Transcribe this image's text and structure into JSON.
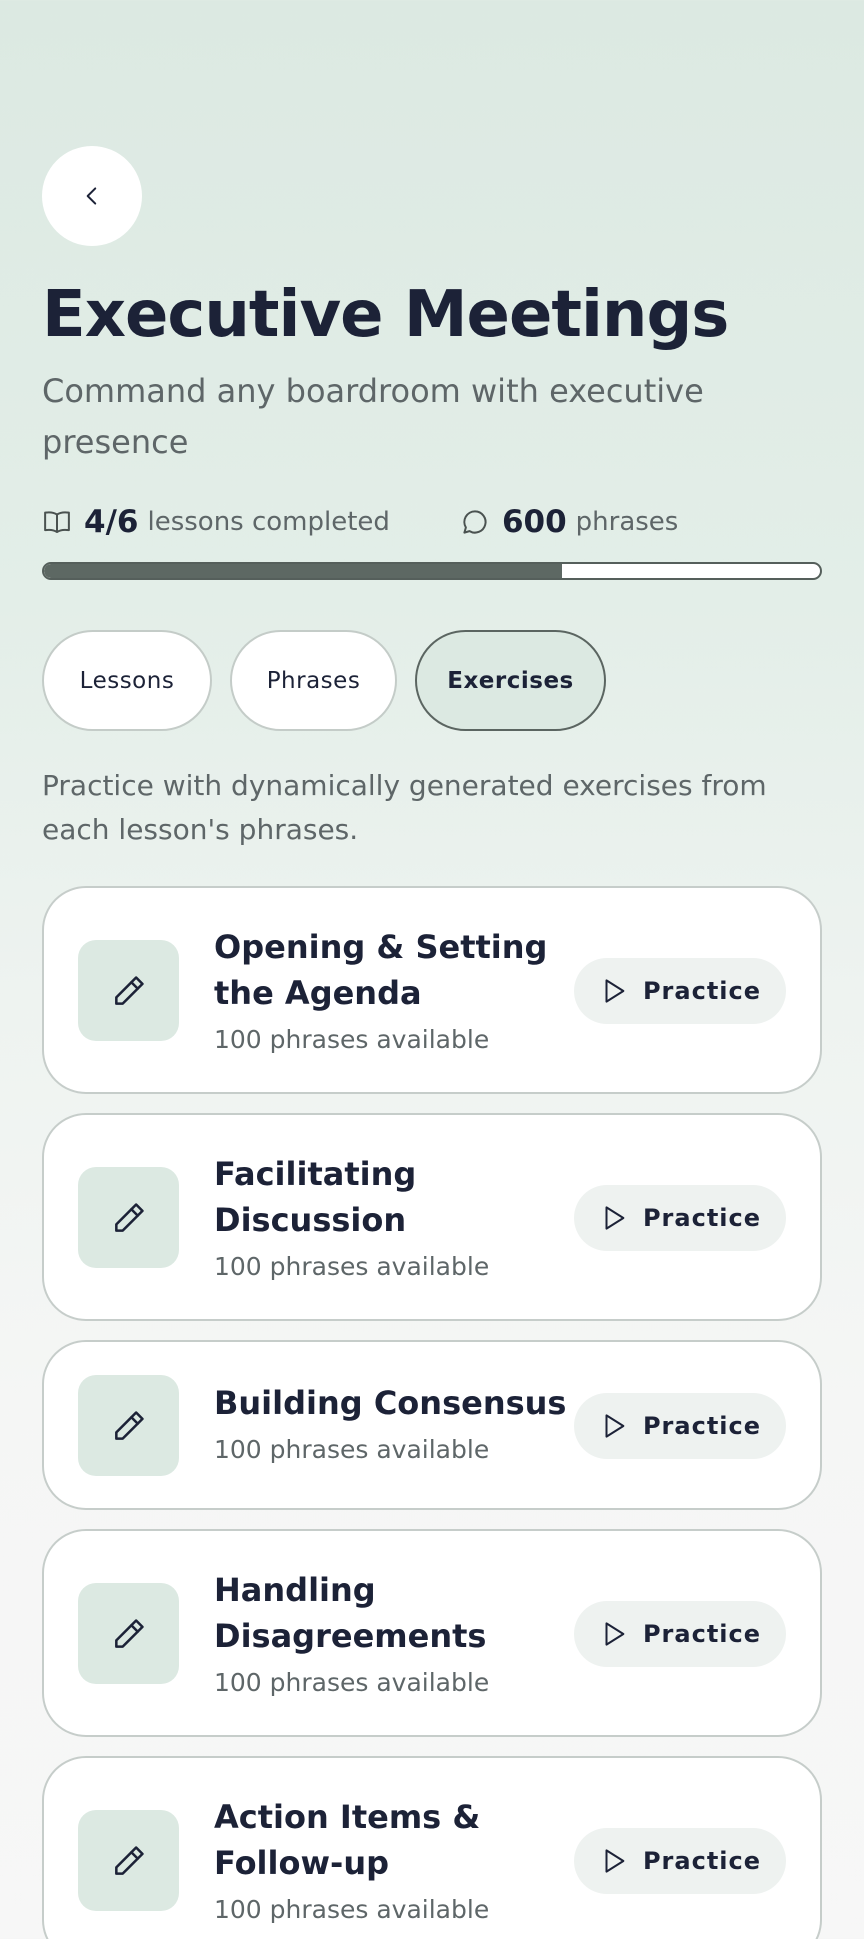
{
  "header": {
    "back_icon": "chevron-left-icon",
    "title": "Executive Meetings",
    "subtitle": "Command any boardroom with executive presence"
  },
  "stats": {
    "lessons": {
      "icon": "book-icon",
      "value": "4/6",
      "label": "lessons completed"
    },
    "phrases": {
      "icon": "chat-bubble-icon",
      "value": "600",
      "label": "phrases"
    },
    "progress_fraction": 0.667
  },
  "tabs": [
    {
      "label": "Lessons",
      "active": false
    },
    {
      "label": "Phrases",
      "active": false
    },
    {
      "label": "Exercises",
      "active": true
    }
  ],
  "description": "Practice with dynamically generated exercises from each lesson's phrases.",
  "exercises": [
    {
      "icon": "pencil-icon",
      "title": "Opening & Setting the Agenda",
      "subtitle": "100 phrases available",
      "button_label": "Practice",
      "button_icon": "play-icon"
    },
    {
      "icon": "pencil-icon",
      "title": "Facilitating Discussion",
      "subtitle": "100 phrases available",
      "button_label": "Practice",
      "button_icon": "play-icon"
    },
    {
      "icon": "pencil-icon",
      "title": "Building Consensus",
      "subtitle": "100 phrases available",
      "button_label": "Practice",
      "button_icon": "play-icon"
    },
    {
      "icon": "pencil-icon",
      "title": "Handling Disagreements",
      "subtitle": "100 phrases available",
      "button_label": "Practice",
      "button_icon": "play-icon"
    },
    {
      "icon": "pencil-icon",
      "title": "Action Items & Follow-up",
      "subtitle": "100 phrases available",
      "button_label": "Practice",
      "button_icon": "play-icon"
    }
  ],
  "colors": {
    "accent_bg": "#dce9e2",
    "text_dark": "#1c2237",
    "text_muted": "#5e6668",
    "progress_fill": "#5d6863"
  }
}
